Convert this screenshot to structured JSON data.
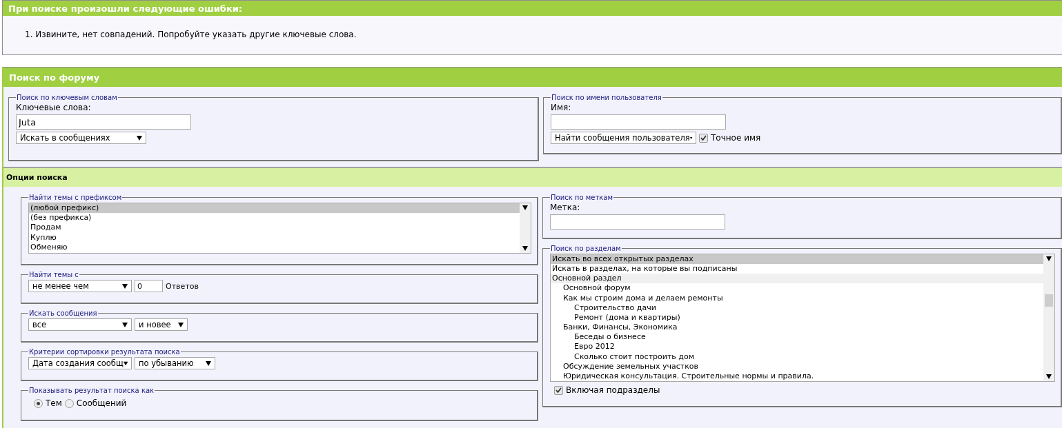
{
  "error_box": {
    "title": "При поиске произошли следующие ошибки:",
    "errors": [
      {
        "number": "1.",
        "text": "Извините, нет совпадений. Попробуйте указать другие ключевые слова."
      }
    ]
  },
  "search_panel": {
    "title": "Поиск по форуму",
    "keywords": {
      "legend": "Поиск по ключевым словам",
      "label": "Ключевые слова:",
      "value": "Juta",
      "mode": "Искать в сообщениях"
    },
    "user": {
      "legend": "Поиск по имени пользователя",
      "label": "Имя:",
      "mode": "Найти сообщения пользователя",
      "exact": {
        "label": "Точное имя",
        "checked": true
      }
    },
    "options_title": "Опции поиска",
    "prefix": {
      "legend": "Найти темы с префиксом",
      "items": [
        {
          "label": "(любой префикс)",
          "selected": true
        },
        {
          "label": "(без префикса)",
          "selected": false
        },
        {
          "label": "Продам",
          "selected": false
        },
        {
          "label": "Куплю",
          "selected": false
        },
        {
          "label": "Обменяю",
          "selected": false
        }
      ]
    },
    "replies": {
      "legend": "Найти темы с",
      "mode": "не менее чем",
      "value": "0",
      "unit": "Ответов"
    },
    "posts": {
      "legend": "Искать сообщения",
      "period": "все",
      "direction": "и новее"
    },
    "sort": {
      "legend": "Критерии сортировки результата поиска",
      "field": "Дата создания сообщ",
      "order": "по убыванию"
    },
    "show_as": {
      "legend": "Показывать результат поиска как",
      "options": [
        {
          "label": "Тем",
          "selected": true
        },
        {
          "label": "Сообщений",
          "selected": false
        }
      ]
    },
    "tags": {
      "legend": "Поиск по меткам",
      "label": "Метка:"
    },
    "forums": {
      "legend": "Поиск по разделам",
      "items": [
        {
          "label": "Искать во всех открытых разделах",
          "selected": true,
          "kind": "option"
        },
        {
          "label": "Искать в разделах, на которые вы подписаны",
          "selected": false,
          "kind": "option"
        },
        {
          "label": "Основной раздел",
          "selected": false,
          "kind": "category",
          "children": [
            {
              "label": "Основной форум",
              "selected": false,
              "kind": "forum"
            },
            {
              "label": "Как мы строим дома и делаем ремонты",
              "selected": false,
              "kind": "forum",
              "children": [
                {
                  "label": "Строительство дачи",
                  "selected": false,
                  "kind": "forum"
                },
                {
                  "label": "Ремонт (дома и квартиры)",
                  "selected": false,
                  "kind": "forum"
                }
              ]
            },
            {
              "label": "Банки, Финансы, Экономика",
              "selected": false,
              "kind": "forum",
              "children": [
                {
                  "label": "Беседы о бизнесе",
                  "selected": false,
                  "kind": "forum"
                },
                {
                  "label": "Евро 2012",
                  "selected": false,
                  "kind": "forum"
                },
                {
                  "label": "Сколько стоит построить дом",
                  "selected": false,
                  "kind": "forum"
                }
              ]
            },
            {
              "label": "Обсуждение земельных участков",
              "selected": false,
              "kind": "forum"
            },
            {
              "label": "Юридическая консультация. Строительные нормы и правила.",
              "selected": false,
              "kind": "forum"
            }
          ]
        }
      ],
      "include_children": {
        "label": "Включая подразделы",
        "checked": true
      }
    }
  }
}
